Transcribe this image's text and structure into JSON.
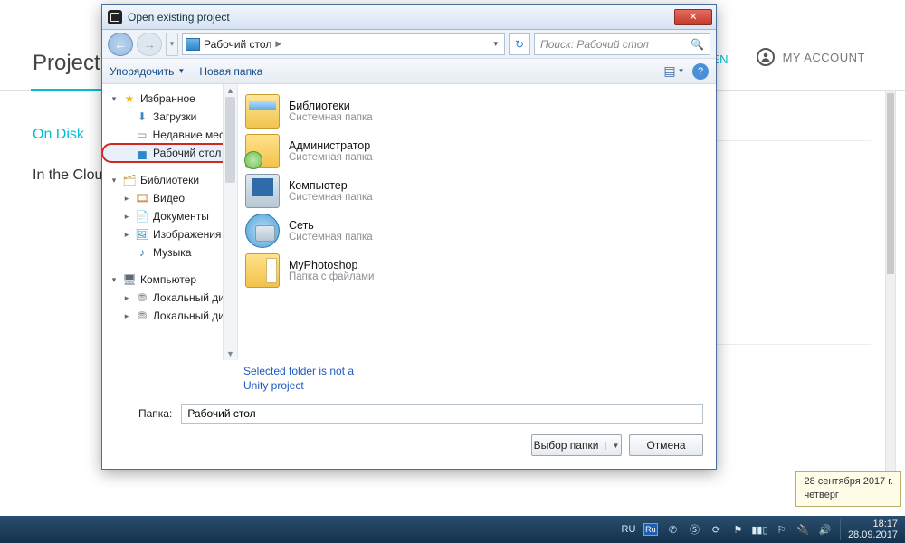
{
  "unity": {
    "projects_heading": "Project",
    "open_link": "OPEN",
    "account": "MY ACCOUNT",
    "on_disk": "On Disk",
    "in_cloud": "In the Clou"
  },
  "dialog": {
    "title": "Open existing project",
    "path_segment": "Рабочий стол",
    "search_placeholder": "Поиск: Рабочий стол",
    "organize": "Упорядочить",
    "new_folder": "Новая папка",
    "warning_line1": "Selected folder is not a",
    "warning_line2": "Unity project",
    "folder_label": "Папка:",
    "folder_value": "Рабочий стол",
    "btn_select": "Выбор папки",
    "btn_cancel": "Отмена"
  },
  "tree": {
    "favorites": "Избранное",
    "downloads": "Загрузки",
    "recent": "Недавние места",
    "desktop": "Рабочий стол",
    "libraries": "Библиотеки",
    "video": "Видео",
    "documents": "Документы",
    "images": "Изображения",
    "music": "Музыка",
    "computer": "Компьютер",
    "localdisk1": "Локальный диск",
    "localdisk2": "Локальный диск"
  },
  "files": {
    "sys_folder": "Системная папка",
    "file_folder": "Папка с файлами",
    "items": [
      {
        "name": "Библиотеки"
      },
      {
        "name": "Администратор"
      },
      {
        "name": "Компьютер"
      },
      {
        "name": "Сеть"
      },
      {
        "name": "MyPhotoshop"
      }
    ]
  },
  "tooltip": {
    "line1": "28 сентября 2017 г.",
    "line2": "четверг"
  },
  "taskbar": {
    "lang": "RU",
    "ru_box": "Ru",
    "time": "18:17",
    "date": "28.09.2017"
  }
}
